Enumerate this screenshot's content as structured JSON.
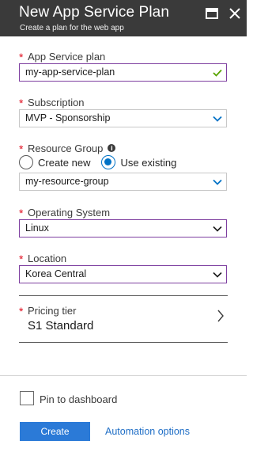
{
  "header": {
    "title": "New App Service Plan",
    "subtitle": "Create a plan for the web app",
    "maximize_icon": "maximize-icon",
    "close_icon": "close-icon",
    "background": "#3a3a3a"
  },
  "form": {
    "required_mark": "*",
    "plan_name": {
      "label": "App Service plan",
      "value": "my-app-service-plan",
      "valid": true
    },
    "subscription": {
      "label": "Subscription",
      "value": "MVP - Sponsorship"
    },
    "resource_group": {
      "label": "Resource Group",
      "info_icon": "i",
      "options": [
        "Create new",
        "Use existing"
      ],
      "selected": "Use existing",
      "value": "my-resource-group"
    },
    "operating_system": {
      "label": "Operating System",
      "value": "Linux"
    },
    "location": {
      "label": "Location",
      "value": "Korea Central"
    },
    "pricing_tier": {
      "label": "Pricing tier",
      "value": "S1 Standard"
    }
  },
  "footer": {
    "pin_label": "Pin to dashboard",
    "pin_checked": false,
    "create_label": "Create",
    "automation_label": "Automation options"
  },
  "colors": {
    "accent": "#2b7ad7",
    "link": "#1f6ec6",
    "required": "#e00b1c",
    "focus_border": "#7e3fa0",
    "valid_check": "#57a300",
    "chevron_blue": "#0072c6"
  }
}
